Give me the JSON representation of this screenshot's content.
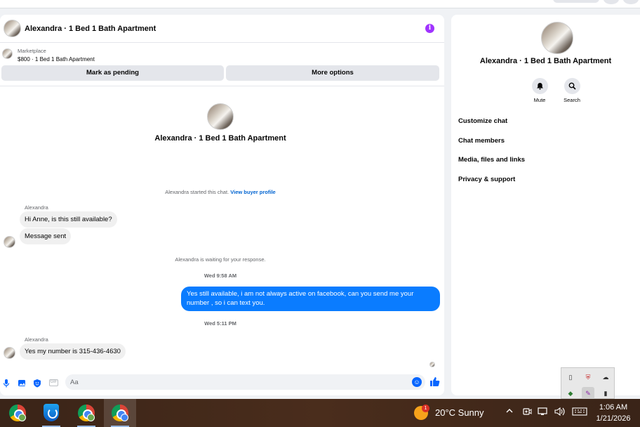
{
  "chat": {
    "title": "Alexandra · 1 Bed 1 Bath Apartment",
    "listing": {
      "source": "Marketplace",
      "description": "$800 · 1 Bed 1 Bath Apartment"
    },
    "buttons": {
      "pending": "Mark as pending",
      "more": "More options"
    },
    "intro_title": "Alexandra · 1 Bed 1 Bath Apartment",
    "started_text": "Alexandra started this chat.",
    "buyer_profile_link": "View buyer profile",
    "messages": [
      {
        "sender": "Alexandra",
        "text": "Hi Anne, is this still available?"
      },
      {
        "text": "Message sent"
      }
    ],
    "waiting_text": "Alexandra is waiting for your response.",
    "time1": "Wed 9:58 AM",
    "outgoing": "Yes still available, i am not always active on facebook, can you send me your number , so i can text you.",
    "time2": "Wed 5:11 PM",
    "reply": {
      "sender": "Alexandra",
      "text": "Yes my number is 315-436-4630"
    },
    "composer": {
      "placeholder": "Aa",
      "gif_label": "GIF"
    }
  },
  "side": {
    "title": "Alexandra · 1 Bed 1 Bath Apartment",
    "actions": {
      "mute": "Mute",
      "search": "Search"
    },
    "items": [
      "Customize chat",
      "Chat members",
      "Media, files and links",
      "Privacy & support"
    ]
  },
  "taskbar": {
    "weather_badge": "1",
    "weather": "20°C  Sunny",
    "time": "1:06 AM",
    "date": "1/21/2026"
  },
  "colors": {
    "accent": "#0866ff",
    "outgoing_bubble": "#0a7cff",
    "info": "#a033ff"
  }
}
